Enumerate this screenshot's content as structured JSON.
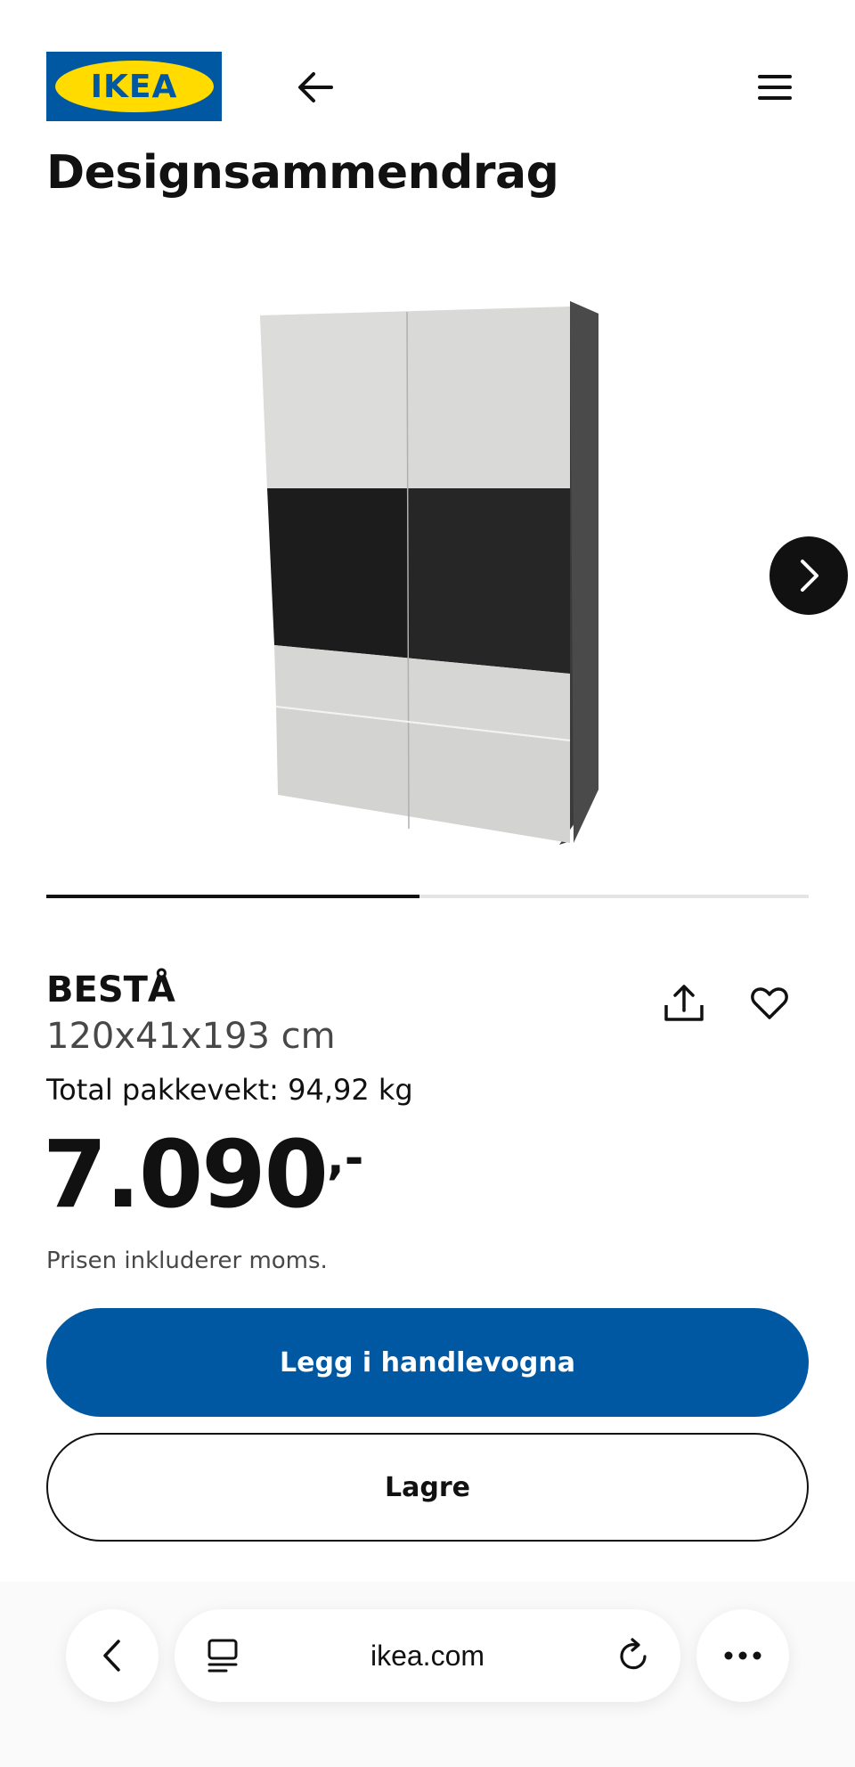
{
  "header": {
    "logo_text": "IKEA",
    "back_icon": "arrow-left-icon",
    "menu_icon": "hamburger-menu-icon"
  },
  "page_title": "Designsammendrag",
  "gallery": {
    "next_icon": "chevron-right-icon",
    "progress": 0.49
  },
  "product": {
    "name": "BESTÅ",
    "dimensions": "120x41x193 cm",
    "weight_text": "Total pakkevekt: 94,92 kg",
    "price_integer": "7.090",
    "price_decimal": ",-",
    "vat_note": "Prisen inkluderer moms.",
    "share_icon": "share-icon",
    "favorite_icon": "heart-icon"
  },
  "actions": {
    "add_to_cart": "Legg i handlevogna",
    "save": "Lagre"
  },
  "browser": {
    "url": "ikea.com",
    "back_icon": "chevron-left-icon",
    "tabs_icon": "tab-view-icon",
    "reload_icon": "reload-icon",
    "more_icon": "more-dots-icon"
  },
  "colors": {
    "ikea_blue": "#0058a3",
    "ikea_yellow": "#ffdb00",
    "text": "#111111"
  }
}
